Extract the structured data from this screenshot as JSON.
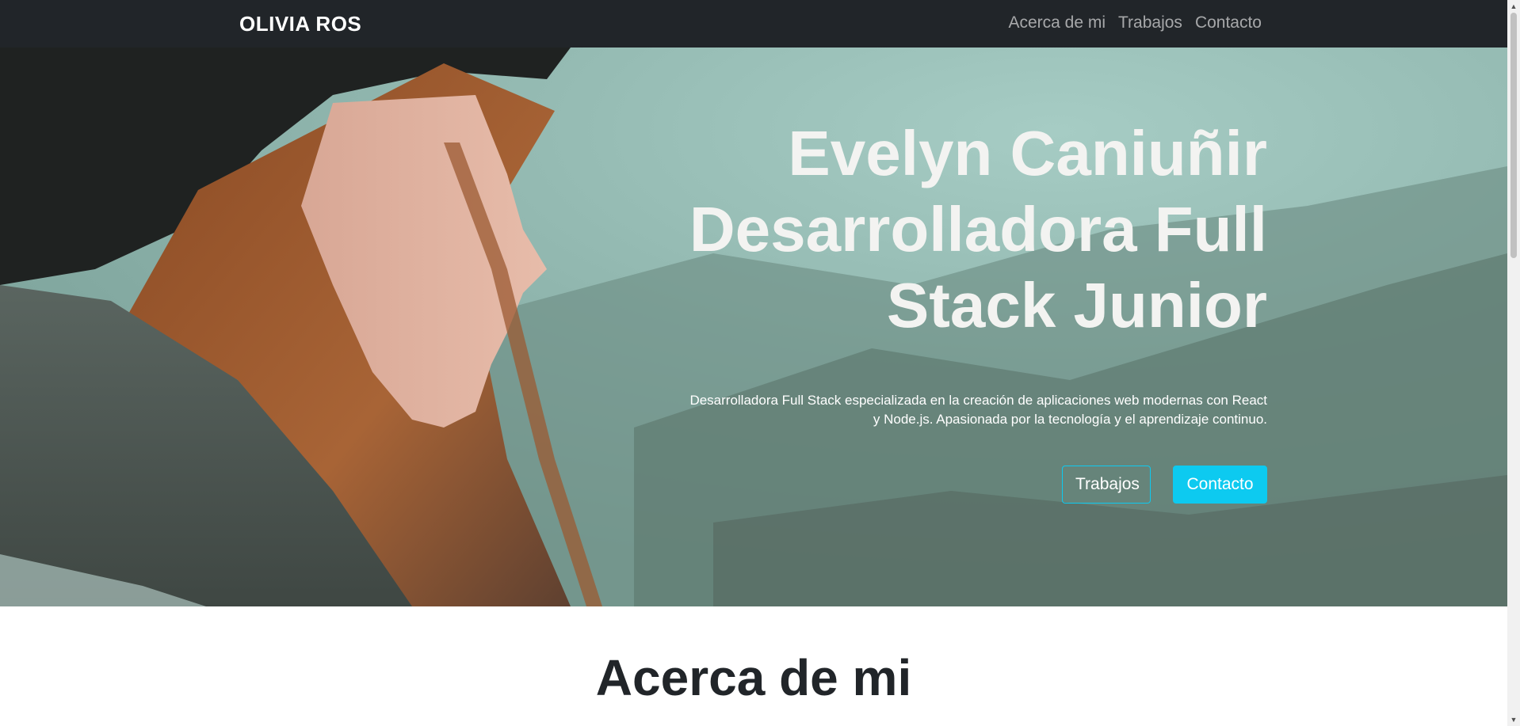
{
  "navbar": {
    "brand": "OLIVIA ROS",
    "links": [
      "Acerca de mi",
      "Trabajos",
      "Contacto"
    ]
  },
  "hero": {
    "title": "Evelyn Caniuñir Desarrolladora Full Stack Junior",
    "description": "Desarrolladora Full Stack especializada en la creación de aplicaciones web modernas con React y Node.js. Apasionada por la tecnología y el aprendizaje continuo.",
    "buttons": {
      "outline_label": "Trabajos",
      "solid_label": "Contacto"
    }
  },
  "about": {
    "title": "Acerca de mi"
  },
  "colors": {
    "navbar_bg": "#212529",
    "accent": "#0dcaf0",
    "heading_dark": "#212529"
  },
  "icons": {
    "scroll_up": "chevron-up-icon",
    "scroll_down": "chevron-down-icon"
  }
}
